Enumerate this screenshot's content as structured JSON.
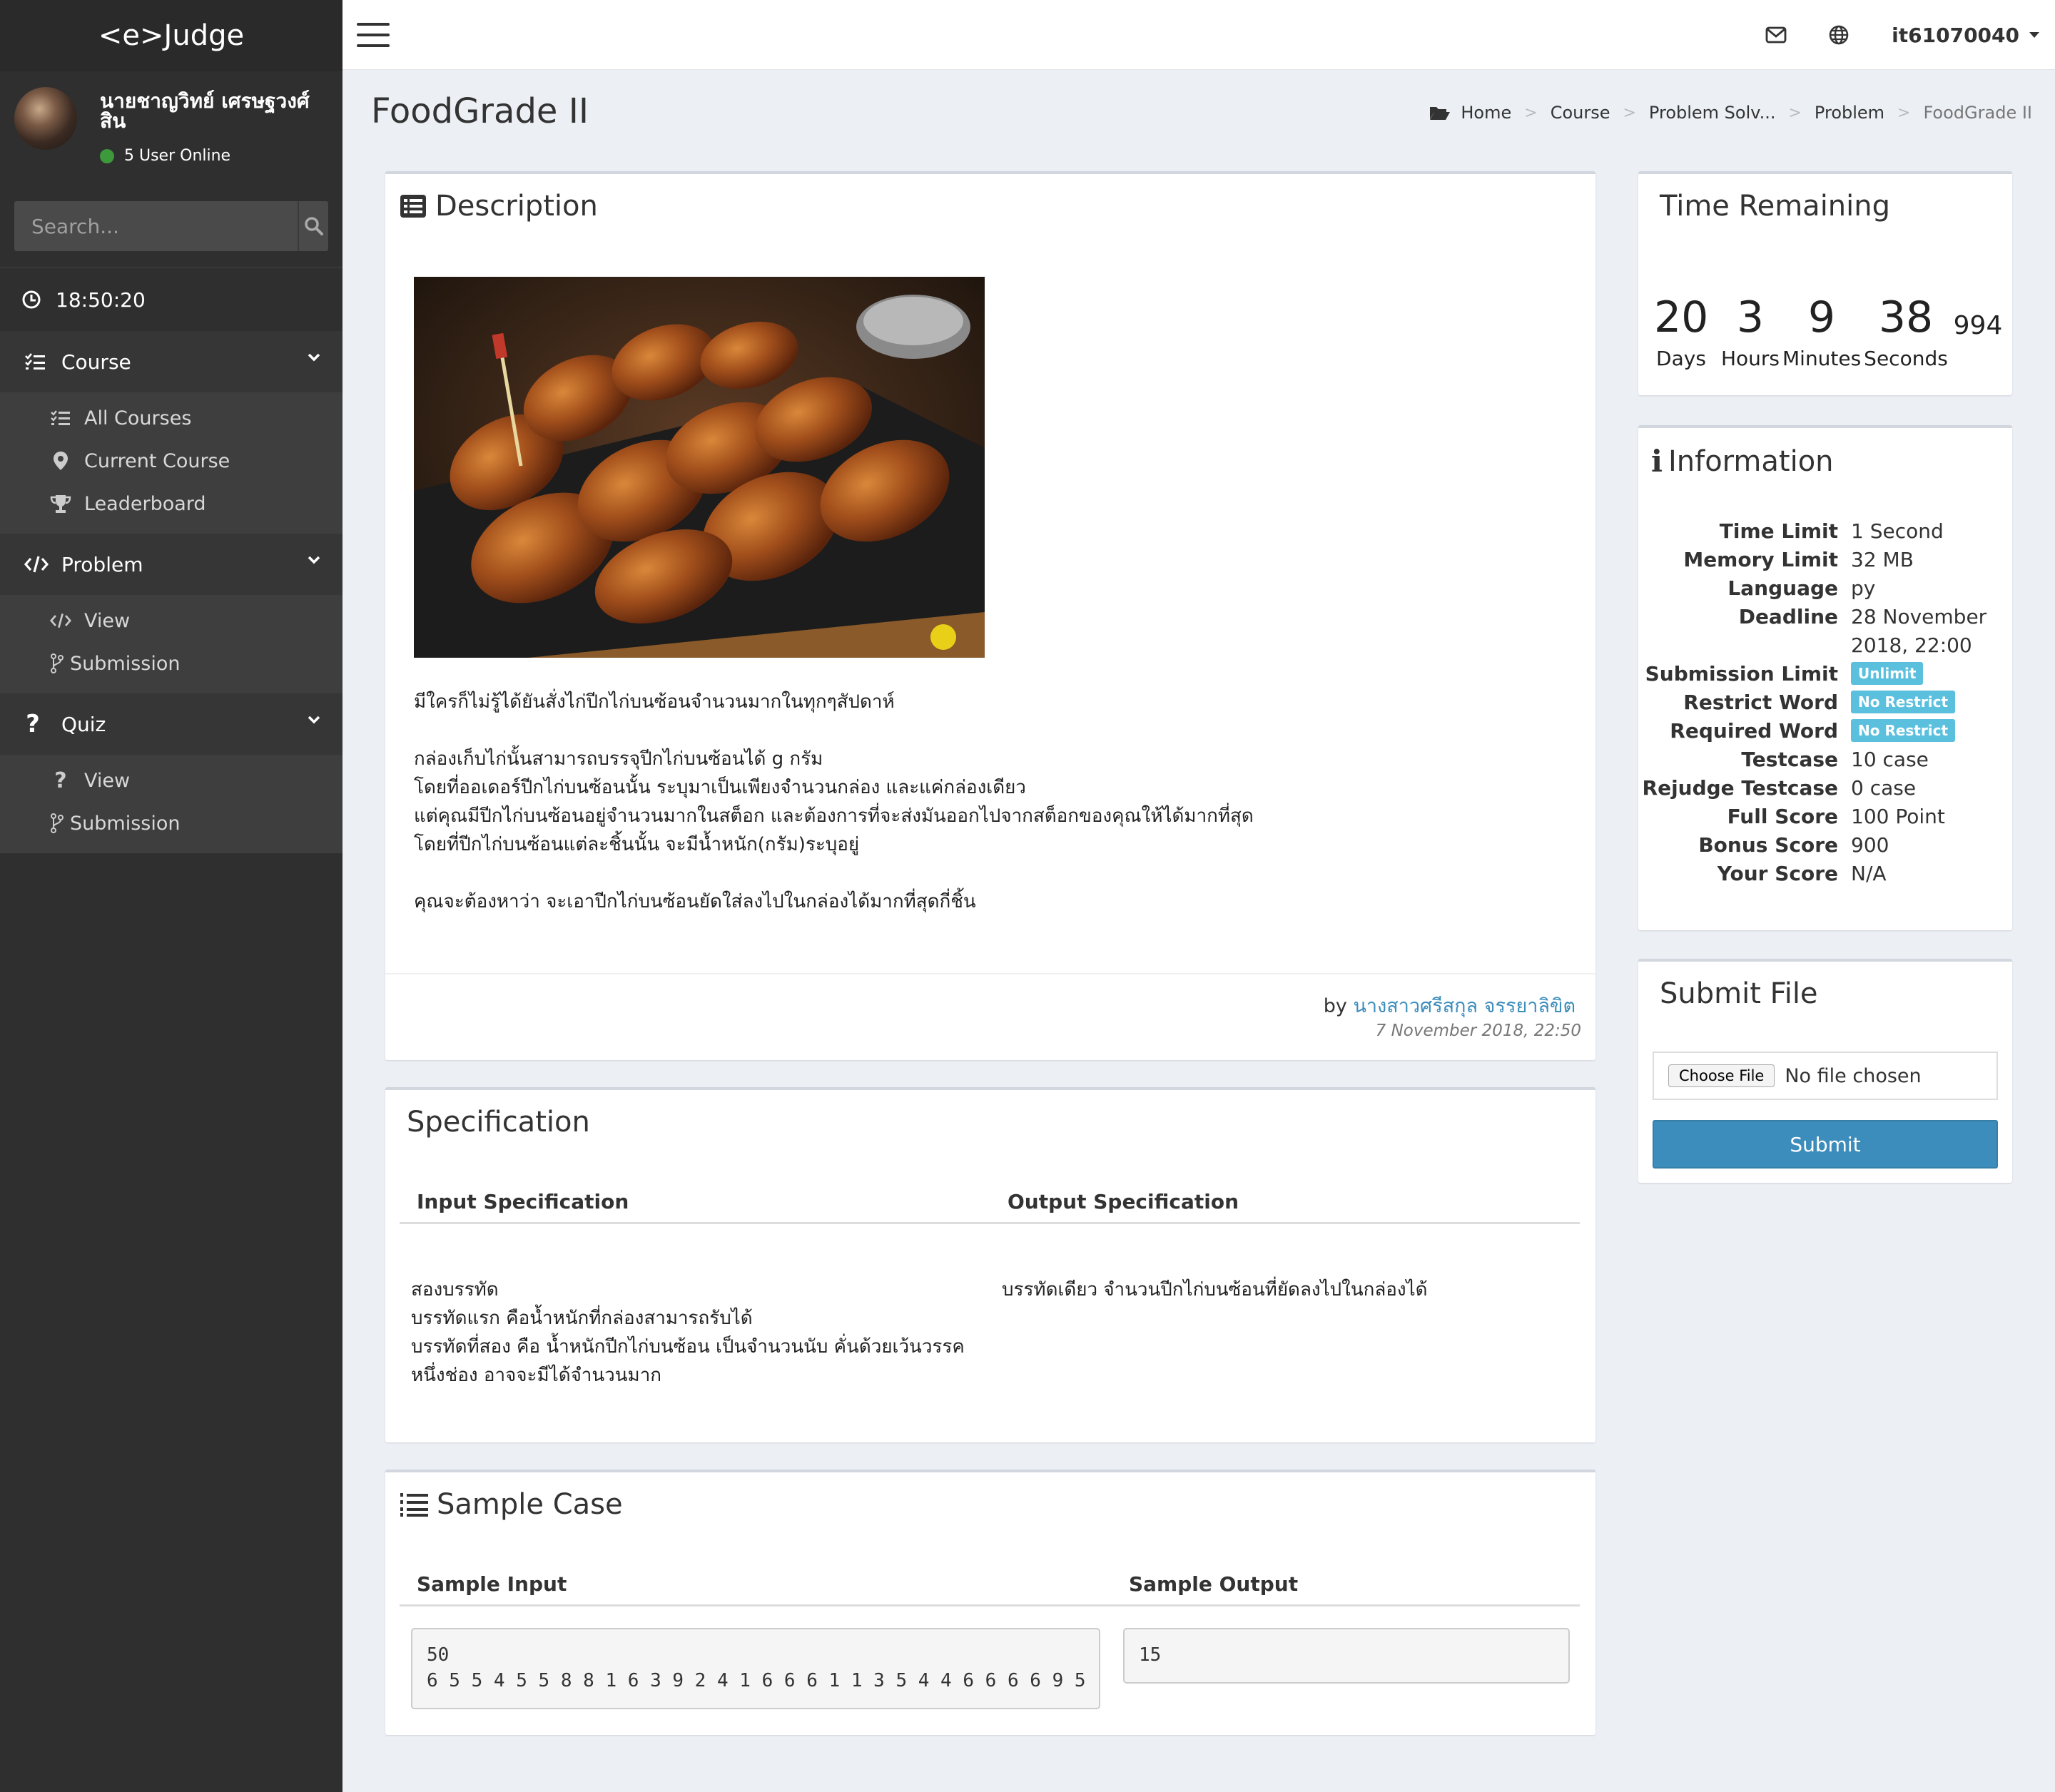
{
  "app": {
    "logo": "<e>Judge"
  },
  "user": {
    "name": "นายชาญวิทย์ เศรษฐวงศ์สิน",
    "online": "5 User Online",
    "username": "it61070040"
  },
  "search": {
    "placeholder": "Search..."
  },
  "clock": "18:50:20",
  "menu": {
    "course": {
      "label": "Course",
      "items": [
        "All Courses",
        "Current Course",
        "Leaderboard"
      ]
    },
    "problem": {
      "label": "Problem",
      "items": [
        "View",
        "Submission"
      ]
    },
    "quiz": {
      "label": "Quiz",
      "items": [
        "View",
        "Submission"
      ]
    }
  },
  "page": {
    "title": "FoodGrade II"
  },
  "breadcrumb": [
    "Home",
    "Course",
    "Problem Solv...",
    "Problem",
    "FoodGrade II"
  ],
  "description": {
    "title": "Description",
    "image_alt": "fried chicken wings",
    "text": "มีใครก็ไม่รู้ได้ยันสั่งไก่ปีกไก่บนซ้อนจำนวนมากในทุกๆสัปดาห์\n\nกล่องเก็บไก่นั้นสามารถบรรจุปีกไก่บนซ้อนได้ g กรัม\nโดยที่ออเดอร์ปีกไก่บนซ้อนนั้น ระบุมาเป็นเพียงจำนวนกล่อง และแค่กล่องเดียว\nแต่คุณมีปีกไก่บนซ้อนอยู่จำนวนมากในสต็อก และต้องการที่จะส่งมันออกไปจากสต็อกของคุณให้ได้มากที่สุด\nโดยที่ปีกไก่บนซ้อนแต่ละชิ้นนั้น จะมีน้ำหนัก(กรัม)ระบุอยู่\n\nคุณจะต้องหาว่า จะเอาปีกไก่บนซ้อนยัดใส่ลงไปในกล่องได้มากที่สุดกี่ชิ้น",
    "by": "by",
    "author": "นางสาวศรีสกุล จรรยาลิขิต",
    "date": "7 November 2018, 22:50"
  },
  "specification": {
    "title": "Specification",
    "input_header": "Input Specification",
    "output_header": "Output Specification",
    "input": "สองบรรทัด\nบรรทัดแรก คือน้ำหนักที่กล่องสามารถรับได้\nบรรทัดที่สอง คือ น้ำหนักปีกไก่บนซ้อน เป็นจำนวนนับ  คั่นด้วยเว้นวรรค\nหนึ่งช่อง อาจจะมีได้จำนวนมาก",
    "output": "บรรทัดเดียว จำนวนปีกไก่บนซ้อนที่ยัดลงไปในกล่องได้"
  },
  "sample": {
    "title": "Sample Case",
    "input_header": "Sample Input",
    "output_header": "Sample Output",
    "input": "50\n6 5 5 4 5 5 8 8 1 6 3 9 2 4 1 6 6 6 1 1 3 5 4 4 6 6 6 6 9 5",
    "output": "15"
  },
  "time_remaining": {
    "title": "Time Remaining",
    "days": "20",
    "hours": "3",
    "minutes": "9",
    "seconds": "38",
    "ms": "994",
    "days_label": "Days",
    "hours_label": "Hours",
    "minutes_label": "Minutes",
    "seconds_label": "Seconds"
  },
  "information": {
    "title": "Information",
    "rows": [
      {
        "k": "Time Limit",
        "v": "1 Second"
      },
      {
        "k": "Memory Limit",
        "v": "32 MB"
      },
      {
        "k": "Language",
        "v": "py"
      },
      {
        "k": "Deadline",
        "v": "28 November",
        "v2": "2018, 22:00"
      },
      {
        "k": "Submission Limit",
        "badge": "Unlimit"
      },
      {
        "k": "Restrict Word",
        "badge": "No Restrict"
      },
      {
        "k": "Required Word",
        "badge": "No Restrict"
      },
      {
        "k": "Testcase",
        "v": "10 case"
      },
      {
        "k": "Rejudge Testcase",
        "v": "0 case"
      },
      {
        "k": "Full Score",
        "v": "100 Point"
      },
      {
        "k": "Bonus Score",
        "v": "900"
      },
      {
        "k": "Your Score",
        "v": "N/A"
      }
    ]
  },
  "submit": {
    "title": "Submit File",
    "choose": "Choose File",
    "no_file": "No file chosen",
    "button": "Submit"
  },
  "colors": {
    "sidebar": "#2f2f2f",
    "accent": "#3c8dbc",
    "badge": "#5bc0de",
    "online": "#3c9a3c"
  }
}
